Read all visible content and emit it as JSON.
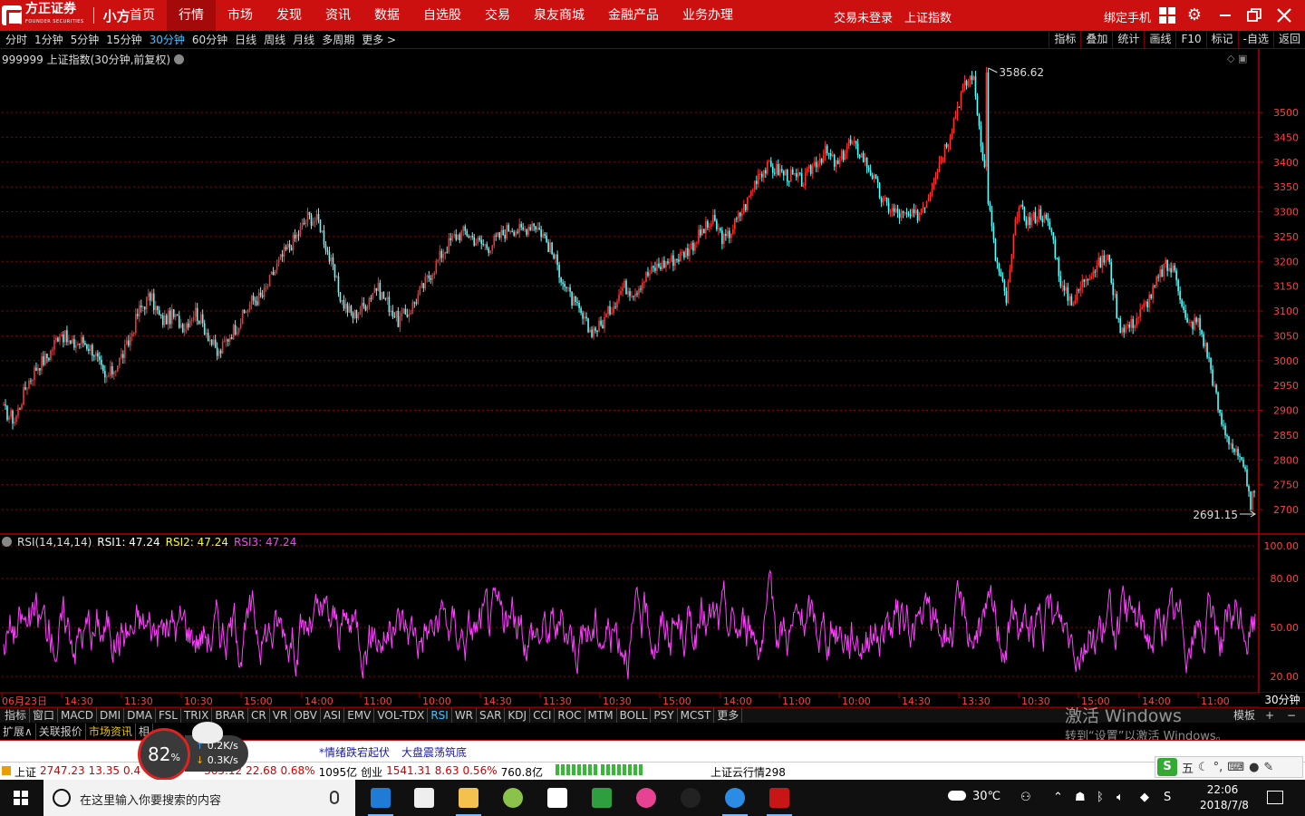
{
  "app": {
    "brand": "方正证券",
    "brand_en": "FOUNDER SECURITIES",
    "app_name": "小方"
  },
  "nav": {
    "items": [
      "首页",
      "行情",
      "市场",
      "发现",
      "资讯",
      "数据",
      "自选股",
      "交易",
      "泉友商城",
      "金融产品",
      "业务办理"
    ],
    "active": 1,
    "login_status": "交易未登录",
    "index_name": "上证指数",
    "bind_phone": "绑定手机",
    "icons": [
      "grid-icon",
      "gear-icon",
      "minimize-icon",
      "restore-icon",
      "close-icon"
    ]
  },
  "periods": {
    "items": [
      "分时",
      "1分钟",
      "5分钟",
      "15分钟",
      "30分钟",
      "60分钟",
      "日线",
      "周线",
      "月线",
      "多周期",
      "更多 >"
    ],
    "active": 4
  },
  "tools": [
    "指标",
    "叠加",
    "统计",
    "画线",
    "F10",
    "标记",
    "-自选",
    "返回"
  ],
  "main_chart": {
    "title": "999999 上证指数(30分钟,前复权)",
    "high_label": "3586.62",
    "low_label": "2691.15",
    "y_ticks": [
      "3500",
      "3450",
      "3400",
      "3350",
      "3300",
      "3250",
      "3200",
      "3150",
      "3100",
      "3050",
      "3000",
      "2950",
      "2900",
      "2850",
      "2800",
      "2750",
      "2700"
    ]
  },
  "rsi_panel": {
    "name": "RSI(14,14,14)",
    "rsi1": "RSI1: 47.24",
    "rsi2": "RSI2: 47.24",
    "rsi3": "RSI3: 47.24",
    "y_ticks": [
      "100.00",
      "80.00",
      "50.00",
      "20.00"
    ],
    "colors": {
      "rsi1": "#ffffff",
      "rsi2": "#ffff00",
      "rsi3": "#ff40ff"
    }
  },
  "time_axis": {
    "labels": [
      "06月23日",
      "14:30",
      "11:30",
      "10:30",
      "15:00",
      "14:00",
      "11:00",
      "10:00",
      "14:30",
      "11:30",
      "10:30",
      "15:00",
      "14:00",
      "11:00",
      "10:00",
      "14:30",
      "13:30",
      "10:30",
      "15:00",
      "14:00",
      "11:00"
    ],
    "period": "30分钟"
  },
  "indicators": {
    "items": [
      "指标",
      "窗口",
      "MACD",
      "DMI",
      "DMA",
      "FSL",
      "TRIX",
      "BRAR",
      "CR",
      "VR",
      "OBV",
      "ASI",
      "EMV",
      "VOL-TDX",
      "RSI",
      "WR",
      "SAR",
      "KDJ",
      "CCI",
      "ROC",
      "MTM",
      "BOLL",
      "PSY",
      "MCST",
      "更多"
    ],
    "active": 14,
    "template": "模板",
    "plus": "+",
    "minus": "−"
  },
  "info_tabs": {
    "items": [
      "扩展∧",
      "关联报价",
      "市场资讯",
      "相"
    ],
    "active": 2
  },
  "news": {
    "item1": "*情绪跌宕起伏",
    "item2": "大盘震荡筑底"
  },
  "ticker": {
    "sh_name": "上证",
    "sh_price": "2747.23",
    "sh_change": "13.35",
    "sh_pct": "0.4",
    "mid_price": "365.12",
    "mid_change": "22.68",
    "mid_pct": "0.68%",
    "mid_volume": "1095亿",
    "cy_name": "创业",
    "cy_price": "1541.31",
    "cy_change": "8.63",
    "cy_pct": "0.56%",
    "cy_volume": "760.8亿",
    "info": "上证云行情298"
  },
  "speed_widget": {
    "percent": "82",
    "percent_sign": "%",
    "up_rate": "0.2K/s",
    "down_rate": "0.3K/s"
  },
  "watermark": {
    "line1": "激活 Windows",
    "line2": "转到“设置”以激活 Windows。"
  },
  "ime": {
    "label": "五"
  },
  "taskbar": {
    "search_placeholder": "在这里输入你要搜索的内容",
    "weather": "30℃",
    "time": "22:06",
    "date": "2018/7/8",
    "apps": [
      "edge-icon",
      "store-icon",
      "folder-icon",
      "browser-360-icon",
      "mail-icon",
      "green-app-icon",
      "color-wheel-icon",
      "qq-icon",
      "ie-icon",
      "founder-app-icon"
    ]
  },
  "colors": {
    "up": "#ff3030",
    "down": "#54ffff",
    "rsi": "#ff40ff",
    "grid": "#8a0000",
    "axis_text": "#ff4040"
  },
  "chart_data": [
    {
      "type": "candlestick",
      "title": "999999 上证指数(30分钟,前复权)",
      "ylim": [
        2650,
        3600
      ],
      "high": 3586.62,
      "low": 2691.15,
      "close_path": [
        2900,
        2880,
        2950,
        2990,
        3010,
        3060,
        3030,
        3040,
        3020,
        2960,
        2990,
        3030,
        3100,
        3130,
        3080,
        3090,
        3070,
        3100,
        3060,
        3010,
        3050,
        3080,
        3120,
        3130,
        3180,
        3220,
        3250,
        3290,
        3280,
        3200,
        3120,
        3090,
        3110,
        3150,
        3120,
        3080,
        3100,
        3140,
        3180,
        3220,
        3250,
        3260,
        3240,
        3230,
        3250,
        3270,
        3260,
        3280,
        3250,
        3200,
        3140,
        3100,
        3060,
        3070,
        3110,
        3150,
        3140,
        3170,
        3190,
        3200,
        3210,
        3230,
        3260,
        3280,
        3240,
        3280,
        3320,
        3380,
        3390,
        3380,
        3370,
        3360,
        3400,
        3420,
        3390,
        3440,
        3420,
        3380,
        3320,
        3300,
        3290,
        3290,
        3330,
        3400,
        3460,
        3540,
        3580,
        3400,
        3210,
        3120,
        3310,
        3280,
        3300,
        3260,
        3140,
        3120,
        3170,
        3190,
        3210,
        3070,
        3070,
        3100,
        3140,
        3190,
        3180,
        3070,
        3080,
        3000,
        2880,
        2830,
        2780,
        2720
      ]
    },
    {
      "type": "line",
      "title": "RSI(14,14,14)",
      "ylim": [
        0,
        100
      ],
      "series": [
        {
          "name": "RSI1",
          "last": 47.24
        },
        {
          "name": "RSI2",
          "last": 47.24
        },
        {
          "name": "RSI3",
          "last": 47.24
        }
      ]
    }
  ]
}
